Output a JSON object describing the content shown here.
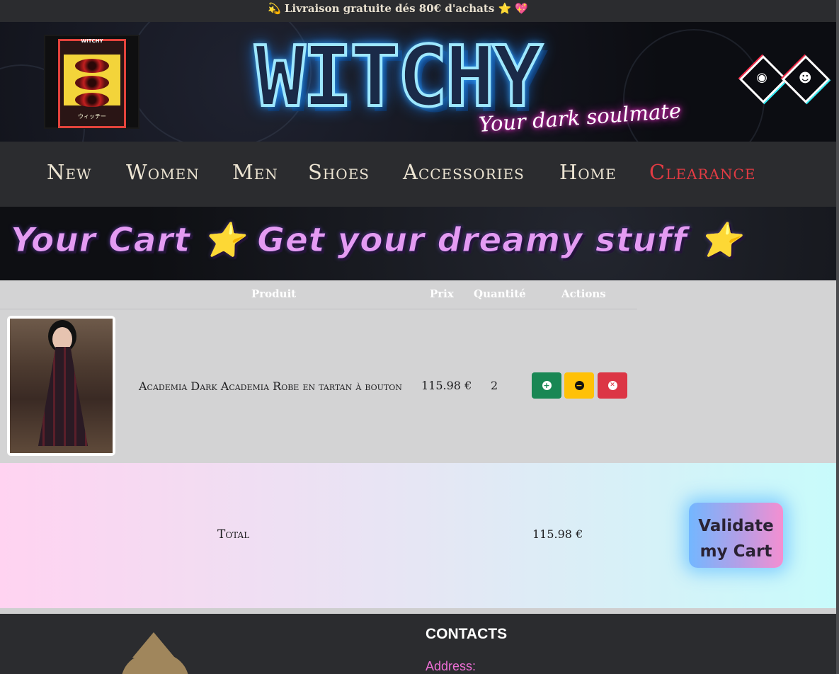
{
  "topbar": {
    "promo": "💫 Livraison gratuite dés 80€ d'achats ⭐ 💖"
  },
  "header": {
    "logo_small_text": "WITCHY",
    "logo_caption": "ウィッチー",
    "brand": "WITCHY",
    "tagline": "Your dark soulmate",
    "icons": [
      "witch-eye-icon",
      "alien-icon"
    ]
  },
  "nav": {
    "items": [
      {
        "label": "New"
      },
      {
        "label": "Women"
      },
      {
        "label": "Men"
      },
      {
        "label": "Shoes"
      },
      {
        "label": "Accessories"
      },
      {
        "label": "Home"
      },
      {
        "label": "Clearance"
      }
    ],
    "accent_color": "#e23b43"
  },
  "banner": {
    "text": "Your Cart ⭐ Get your dreamy stuff ⭐"
  },
  "cart": {
    "columns": [
      "Produit",
      "Prix",
      "Quantité",
      "Actions"
    ],
    "rows": [
      {
        "name": "Academia Dark Academia Robe en tartan à bouton",
        "price": "115.98 €",
        "quantity": "2",
        "actions": [
          "plus-icon",
          "minus-icon",
          "close-icon"
        ]
      }
    ]
  },
  "total": {
    "label": "Total",
    "amount": "115.98 €",
    "validate_label": "Validate my Cart"
  },
  "footer": {
    "contacts_title": "CONTACTS",
    "address_label": "Address:"
  },
  "colors": {
    "success": "#198754",
    "warning": "#ffc107",
    "danger": "#dc3545",
    "footer_accent": "#ee6fd6"
  }
}
